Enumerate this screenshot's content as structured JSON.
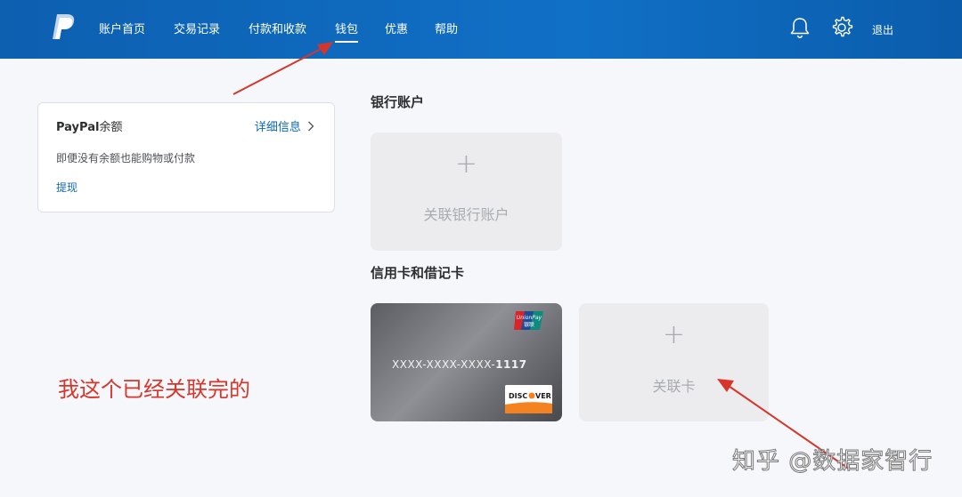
{
  "header": {
    "nav": [
      {
        "label": "账户首页"
      },
      {
        "label": "交易记录"
      },
      {
        "label": "付款和收款"
      },
      {
        "label": "钱包"
      },
      {
        "label": "优惠"
      },
      {
        "label": "帮助"
      }
    ],
    "active_nav": "钱包",
    "logout_label": "退出"
  },
  "balance": {
    "title_brand": "PayPal",
    "title_suffix": "余额",
    "detail_label": "详细信息",
    "description": "即便没有余额也能购物或付款",
    "withdraw_label": "提现"
  },
  "bank": {
    "section_title": "银行账户",
    "add_label": "关联银行账户"
  },
  "cards": {
    "section_title": "信用卡和借记卡",
    "card_prefix": "XXXX-XXXX-XXXX-",
    "card_last4": "1117",
    "add_label": "关联卡"
  },
  "annotation": "我这个已经关联完的",
  "watermark": "知乎 @数据家智行",
  "colors": {
    "header": "#0d5fb0",
    "link": "#0c6ab8",
    "annotation": "#d8352a"
  },
  "icons": [
    "paypal-logo",
    "bell-icon",
    "gear-icon",
    "chevron-right-icon",
    "plus-icon",
    "unionpay-logo",
    "discover-logo"
  ]
}
